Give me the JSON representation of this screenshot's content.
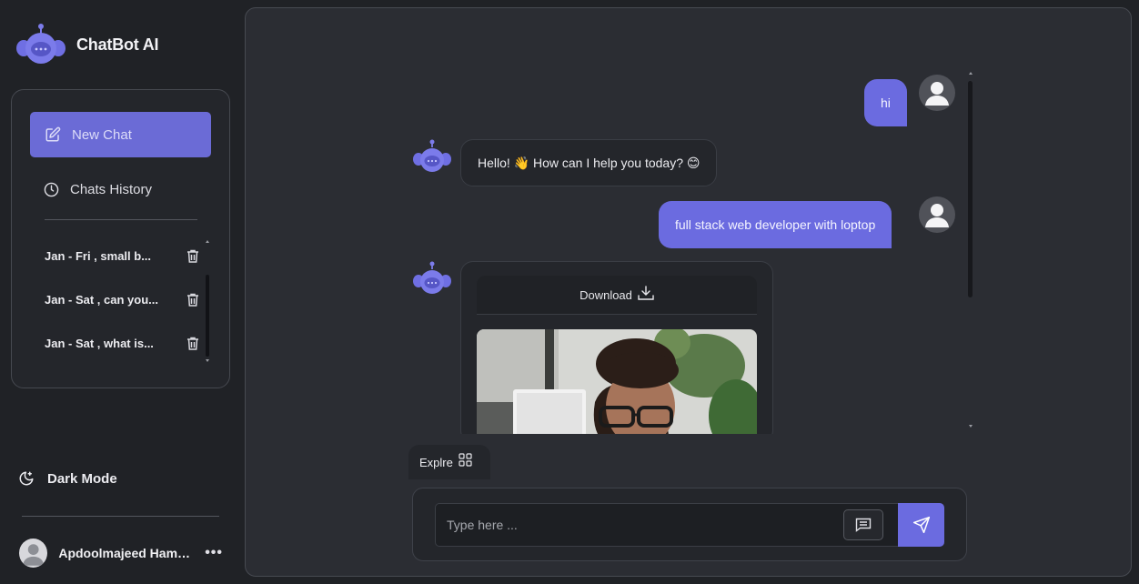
{
  "brand": {
    "name": "ChatBot AI",
    "logo_icon": "robot-icon"
  },
  "sidebar": {
    "new_chat_label": "New Chat",
    "history_label": "Chats History",
    "history_items": [
      {
        "label": "Jan - Fri , small b..."
      },
      {
        "label": "Jan - Sat , can you..."
      },
      {
        "label": "Jan - Sat , what is..."
      }
    ],
    "dark_mode_label": "Dark Mode",
    "user_name": "Apdoolmajeed Hamz...",
    "user_menu": "•••"
  },
  "chat": {
    "messages": [
      {
        "role": "user",
        "text": "hi"
      },
      {
        "role": "bot",
        "text": "Hello! 👋 How can I help you today? 😊"
      },
      {
        "role": "user",
        "text": "full stack web developer with loptop"
      },
      {
        "role": "bot",
        "type": "image",
        "download_label": "Download"
      }
    ]
  },
  "explore_label": "Explre",
  "composer": {
    "placeholder": "Type here ..."
  },
  "colors": {
    "accent": "#6b6be0",
    "background": "#202226",
    "panel": "#2b2d33",
    "bot_bubble": "#24262b"
  }
}
